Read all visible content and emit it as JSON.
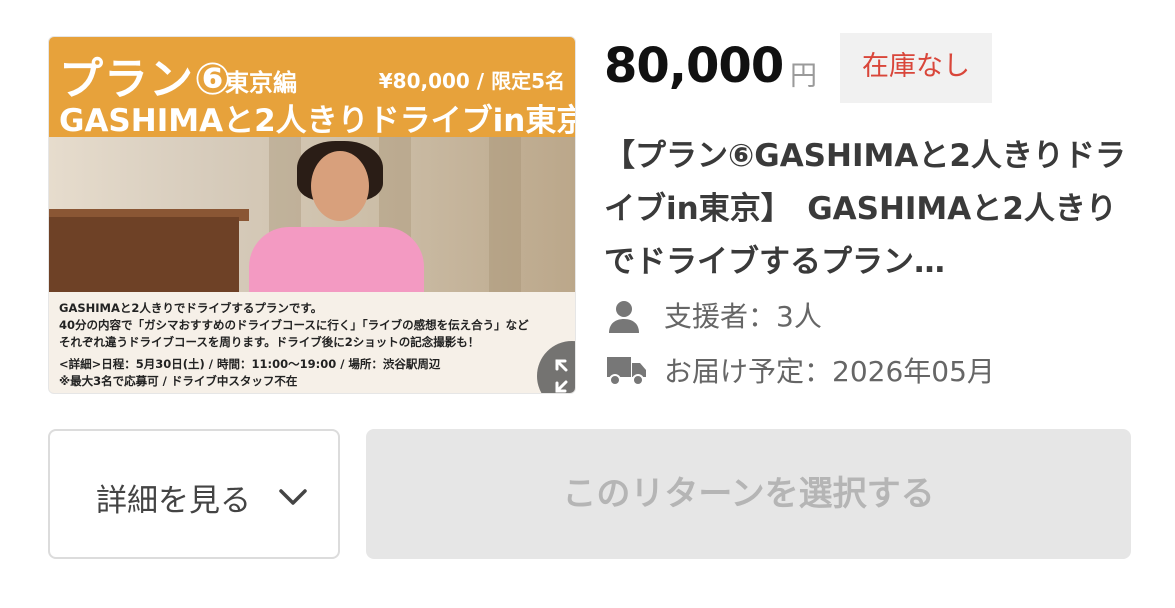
{
  "product_image": {
    "plan_label": "プラン⑥",
    "plan_area": "東京編",
    "plan_price": "¥80,000 / 限定5名",
    "plan_headline": "GASHIMAと2人きりドライブin東京",
    "description_lines": [
      "GASHIMAと2人きりでドライブするプランです。",
      "40分の内容で「ガシマおすすめのドライブコースに行く」「ライブの感想を伝え合う」など",
      "それぞれ違うドライブコースを周ります。ドライブ後に2ショットの記念撮影も！",
      "<詳細>日程：5月30日(土) / 時間：11:00〜19:00 / 場所：渋谷駅周辺",
      "※最大3名で応募可 / ドライブ中スタッフ不在"
    ],
    "expand_icon": "expand-icon"
  },
  "price": {
    "amount": "80,000",
    "unit": "円"
  },
  "stock_badge": "在庫なし",
  "title": "【プラン⑥GASHIMAと2人きりドライブin東京】　GASHIMAと2人きりでドライブするプラン…",
  "supporters": {
    "icon": "person-icon",
    "text": "支援者：3人"
  },
  "delivery": {
    "icon": "truck-icon",
    "text": "お届け予定：2026年05月"
  },
  "buttons": {
    "details_label": "詳細を見る",
    "details_icon": "chevron-down-icon",
    "select_label": "このリターンを選択する"
  },
  "colors": {
    "stock_badge_text": "#d9463a",
    "header_orange": "#e7a23b",
    "disabled_button": "#e6e6e6"
  }
}
